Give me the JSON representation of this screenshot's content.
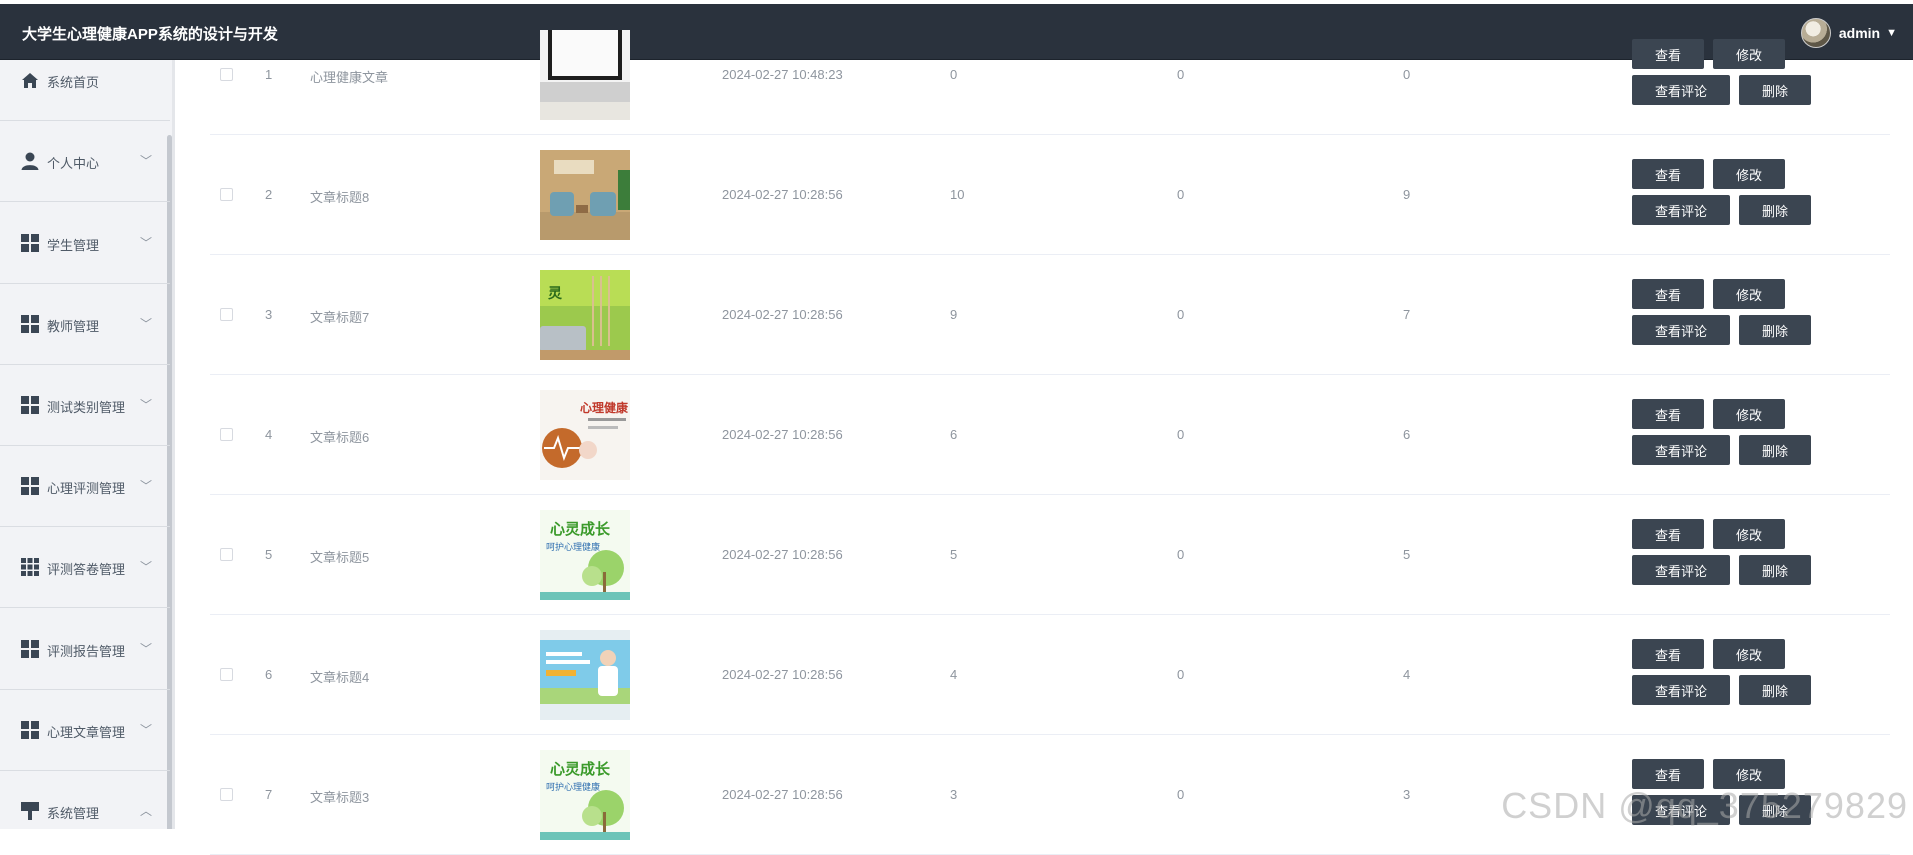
{
  "app": {
    "title": "大学生心理健康APP系统的设计与开发",
    "user": "admin"
  },
  "sidebar": {
    "items": [
      {
        "label": "系统首页",
        "icon": "home-icon"
      },
      {
        "label": "个人中心",
        "icon": "user-icon"
      },
      {
        "label": "学生管理",
        "icon": "grid-icon"
      },
      {
        "label": "教师管理",
        "icon": "grid-icon"
      },
      {
        "label": "测试类别管理",
        "icon": "grid-icon"
      },
      {
        "label": "心理评测管理",
        "icon": "grid-icon"
      },
      {
        "label": "评测答卷管理",
        "icon": "grid9-icon"
      },
      {
        "label": "评测报告管理",
        "icon": "grid-icon"
      },
      {
        "label": "心理文章管理",
        "icon": "grid-icon"
      },
      {
        "label": "系统管理",
        "icon": "tool-icon"
      }
    ]
  },
  "table": {
    "rows": [
      {
        "index": "1",
        "title": "心理健康文章",
        "time": "2024-02-27 10:48:23",
        "c1": "0",
        "c2": "0",
        "c3": "0",
        "image": "laptop-image"
      },
      {
        "index": "2",
        "title": "文章标题8",
        "time": "2024-02-27 10:28:56",
        "c1": "10",
        "c2": "0",
        "c3": "9",
        "image": "counseling-room-image"
      },
      {
        "index": "3",
        "title": "文章标题7",
        "time": "2024-02-27 10:28:56",
        "c1": "9",
        "c2": "0",
        "c3": "7",
        "image": "green-room-image"
      },
      {
        "index": "4",
        "title": "文章标题6",
        "time": "2024-02-27 10:28:56",
        "c1": "6",
        "c2": "0",
        "c3": "6",
        "image": "health-poster-image"
      },
      {
        "index": "5",
        "title": "文章标题5",
        "time": "2024-02-27 10:28:56",
        "c1": "5",
        "c2": "0",
        "c3": "5",
        "image": "growth-poster-image"
      },
      {
        "index": "6",
        "title": "文章标题4",
        "time": "2024-02-27 10:28:56",
        "c1": "4",
        "c2": "0",
        "c3": "4",
        "image": "doctor-banner-image"
      },
      {
        "index": "7",
        "title": "文章标题3",
        "time": "2024-02-27 10:28:56",
        "c1": "3",
        "c2": "0",
        "c3": "3",
        "image": "growth-poster-image"
      }
    ],
    "buttons": {
      "view": "查看",
      "edit": "修改",
      "comments": "查看评论",
      "delete": "删除"
    }
  },
  "poster_text": {
    "grow": "心灵成长",
    "protect": "呵护心理健康",
    "health": "心理健康教育"
  },
  "watermark": "CSDN @qq_375279829"
}
